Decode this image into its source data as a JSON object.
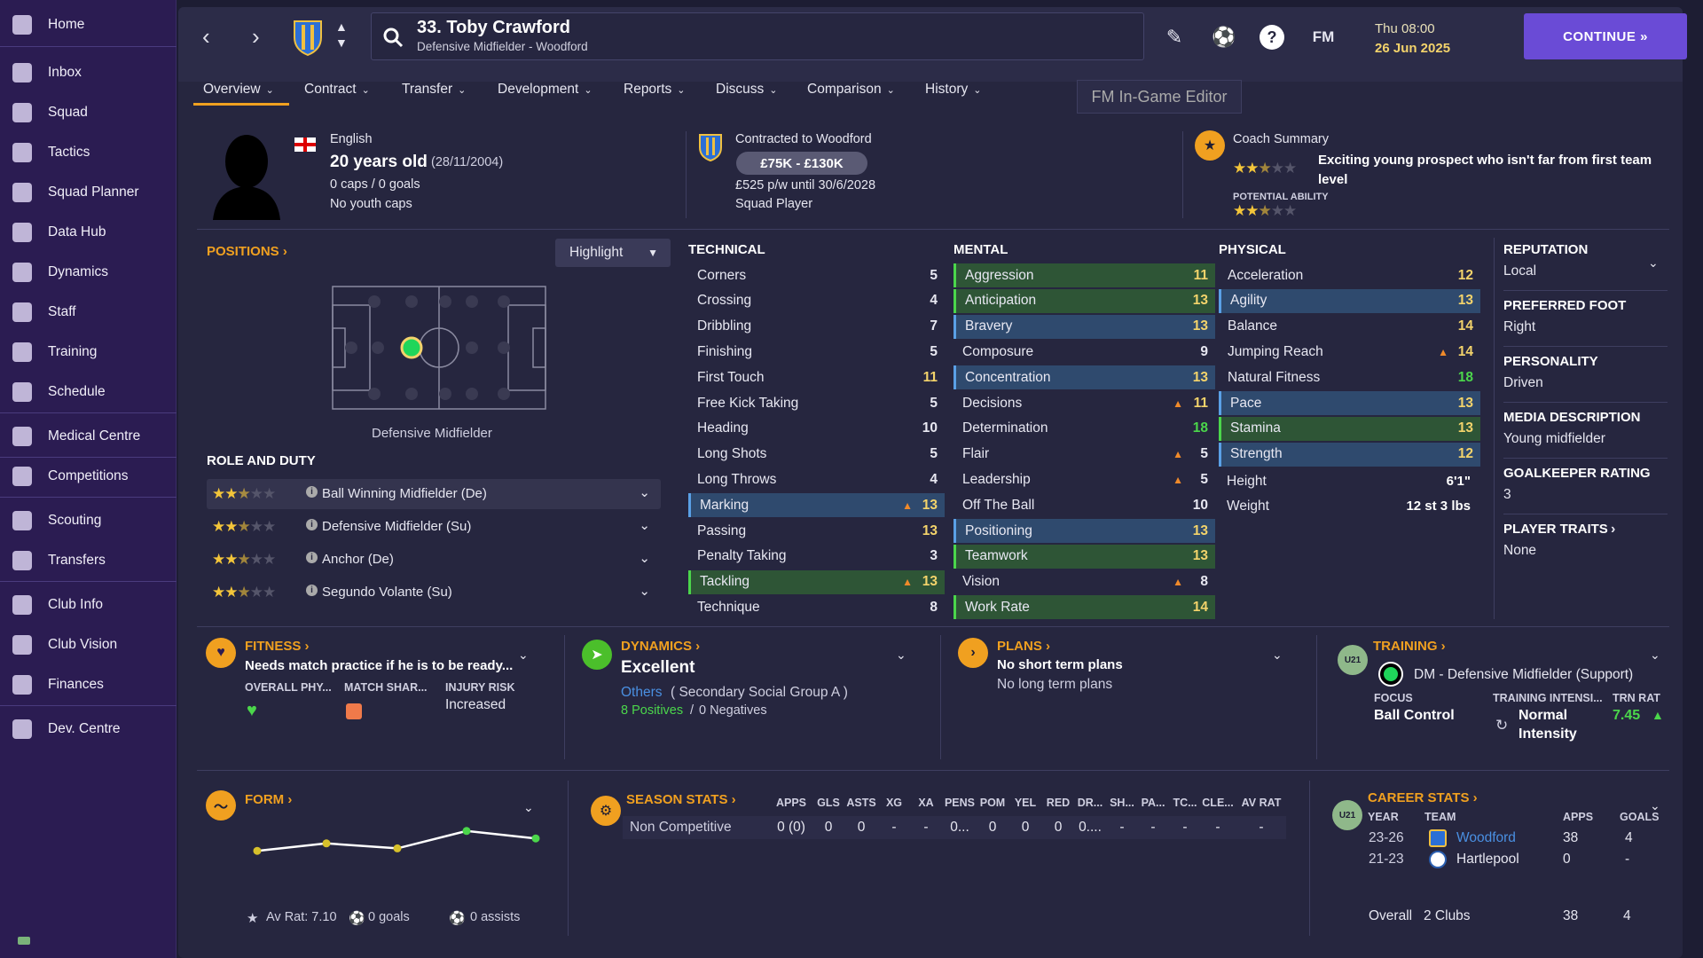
{
  "sidebar": {
    "items": [
      {
        "label": "Home",
        "icon": "home-icon"
      },
      {
        "label": "Inbox",
        "icon": "inbox-icon"
      },
      {
        "label": "Squad",
        "icon": "shirt-icon"
      },
      {
        "label": "Tactics",
        "icon": "tactics-icon"
      },
      {
        "label": "Squad Planner",
        "icon": "planner-icon"
      },
      {
        "label": "Data Hub",
        "icon": "data-hub-icon"
      },
      {
        "label": "Dynamics",
        "icon": "dynamics-icon"
      },
      {
        "label": "Staff",
        "icon": "staff-icon"
      },
      {
        "label": "Training",
        "icon": "training-icon"
      },
      {
        "label": "Schedule",
        "icon": "calendar-icon"
      },
      {
        "label": "Medical Centre",
        "icon": "medical-icon"
      },
      {
        "label": "Competitions",
        "icon": "trophy-icon"
      },
      {
        "label": "Scouting",
        "icon": "scouting-icon"
      },
      {
        "label": "Transfers",
        "icon": "transfers-icon"
      },
      {
        "label": "Club Info",
        "icon": "shield-icon"
      },
      {
        "label": "Club Vision",
        "icon": "vision-icon"
      },
      {
        "label": "Finances",
        "icon": "finances-icon"
      },
      {
        "label": "Dev. Centre",
        "icon": "dev-centre-icon"
      }
    ]
  },
  "header": {
    "name": "33. Toby Crawford",
    "sub": "Defensive Midfielder - Woodford",
    "fm": "FM",
    "date1": "Thu 08:00",
    "date2": "26 Jun 2025",
    "continue": "CONTINUE"
  },
  "tabs": [
    "Overview",
    "Contract",
    "Transfer",
    "Development",
    "Reports",
    "Discuss",
    "Comparison",
    "History"
  ],
  "tooltip": "FM In-Game Editor",
  "profile": {
    "nationality": "English",
    "age": "20 years old",
    "dob": "(28/11/2004)",
    "caps": "0 caps / 0 goals",
    "youth": "No youth caps"
  },
  "contract": {
    "title": "Contracted to Woodford",
    "value": "£75K - £130K",
    "wage": "£525 p/w until 30/6/2028",
    "status": "Squad Player"
  },
  "coach": {
    "title": "Coach Summary",
    "text": "Exciting young prospect who isn't far from first team level",
    "pa_label": "POTENTIAL ABILITY",
    "ca_stars": 2.5,
    "pa_stars": 2.5
  },
  "positions": {
    "title": "POSITIONS",
    "highlight": "Highlight",
    "pos_label": "Defensive Midfielder",
    "role_title": "ROLE AND DUTY",
    "roles": [
      {
        "name": "Ball Winning Midfielder (De)",
        "stars": 2.5
      },
      {
        "name": "Defensive Midfielder (Su)",
        "stars": 2.5
      },
      {
        "name": "Anchor (De)",
        "stars": 2.5
      },
      {
        "name": "Segundo Volante (Su)",
        "stars": 2.5
      }
    ]
  },
  "technical": {
    "title": "TECHNICAL",
    "attrs": [
      {
        "n": "Corners",
        "v": "5"
      },
      {
        "n": "Crossing",
        "v": "4"
      },
      {
        "n": "Dribbling",
        "v": "7"
      },
      {
        "n": "Finishing",
        "v": "5"
      },
      {
        "n": "First Touch",
        "v": "11"
      },
      {
        "n": "Free Kick Taking",
        "v": "5"
      },
      {
        "n": "Heading",
        "v": "10"
      },
      {
        "n": "Long Shots",
        "v": "5"
      },
      {
        "n": "Long Throws",
        "v": "4"
      },
      {
        "n": "Marking",
        "v": "13",
        "hl": "b",
        "up": true
      },
      {
        "n": "Passing",
        "v": "13"
      },
      {
        "n": "Penalty Taking",
        "v": "3"
      },
      {
        "n": "Tackling",
        "v": "13",
        "hl": "g",
        "up": true
      },
      {
        "n": "Technique",
        "v": "8"
      }
    ]
  },
  "mental": {
    "title": "MENTAL",
    "attrs": [
      {
        "n": "Aggression",
        "v": "11",
        "hl": "g"
      },
      {
        "n": "Anticipation",
        "v": "13",
        "hl": "g"
      },
      {
        "n": "Bravery",
        "v": "13",
        "hl": "b"
      },
      {
        "n": "Composure",
        "v": "9"
      },
      {
        "n": "Concentration",
        "v": "13",
        "hl": "b"
      },
      {
        "n": "Decisions",
        "v": "11",
        "up": true
      },
      {
        "n": "Determination",
        "v": "18"
      },
      {
        "n": "Flair",
        "v": "5",
        "up": true
      },
      {
        "n": "Leadership",
        "v": "5",
        "up": true
      },
      {
        "n": "Off The Ball",
        "v": "10"
      },
      {
        "n": "Positioning",
        "v": "13",
        "hl": "b"
      },
      {
        "n": "Teamwork",
        "v": "13",
        "hl": "g"
      },
      {
        "n": "Vision",
        "v": "8",
        "up": true
      },
      {
        "n": "Work Rate",
        "v": "14",
        "hl": "g"
      }
    ]
  },
  "physical": {
    "title": "PHYSICAL",
    "attrs": [
      {
        "n": "Acceleration",
        "v": "12"
      },
      {
        "n": "Agility",
        "v": "13",
        "hl": "b"
      },
      {
        "n": "Balance",
        "v": "14"
      },
      {
        "n": "Jumping Reach",
        "v": "14",
        "up": true
      },
      {
        "n": "Natural Fitness",
        "v": "18"
      },
      {
        "n": "Pace",
        "v": "13",
        "hl": "b"
      },
      {
        "n": "Stamina",
        "v": "13",
        "hl": "g"
      },
      {
        "n": "Strength",
        "v": "12",
        "hl": "b"
      }
    ],
    "height_l": "Height",
    "height": "6'1\"",
    "weight_l": "Weight",
    "weight": "12 st 3 lbs"
  },
  "info": {
    "reputation_l": "REPUTATION",
    "reputation": "Local",
    "foot_l": "PREFERRED FOOT",
    "foot": "Right",
    "pers_l": "PERSONALITY",
    "pers": "Driven",
    "media_l": "MEDIA DESCRIPTION",
    "media": "Young midfielder",
    "gk_l": "GOALKEEPER RATING",
    "gk": "3",
    "traits_l": "PLAYER TRAITS",
    "traits": "None"
  },
  "fitness": {
    "title": "FITNESS",
    "text": "Needs match practice if he is to be ready...",
    "c1": "OVERALL PHY...",
    "c2": "MATCH SHAR...",
    "c3": "INJURY RISK",
    "risk": "Increased"
  },
  "dynamics": {
    "title": "DYNAMICS",
    "value": "Excellent",
    "group_link": "Others",
    "group": "( Secondary Social Group A )",
    "pos": "8 Positives",
    "sep": "/",
    "neg": "0 Negatives"
  },
  "plans": {
    "title": "PLANS",
    "short": "No short term plans",
    "long": "No long term plans"
  },
  "training": {
    "title": "TRAINING",
    "badge": "U21",
    "role": "DM - Defensive Midfielder (Support)",
    "focus_l": "FOCUS",
    "focus": "Ball Control",
    "int_l": "TRAINING INTENSI...",
    "int1": "Normal",
    "int2": "Intensity",
    "rat_l": "TRN RAT",
    "rat": "7.45"
  },
  "form": {
    "title": "FORM",
    "av": "Av Rat: 7.10",
    "goals": "0 goals",
    "assists": "0 assists",
    "points": [
      6.6,
      6.9,
      6.7,
      7.4,
      7.1
    ]
  },
  "season": {
    "title": "SEASON STATS",
    "cols": [
      "APPS",
      "GLS",
      "ASTS",
      "XG",
      "XA",
      "PENS",
      "POM",
      "YEL",
      "RED",
      "DR...",
      "SH...",
      "PA...",
      "TC...",
      "CLE...",
      "AV RAT"
    ],
    "row_label": "Non Competitive",
    "row": [
      "0 (0)",
      "0",
      "0",
      "-",
      "-",
      "0...",
      "0",
      "0",
      "0",
      "0....",
      "-",
      "-",
      "-",
      "-",
      "-"
    ]
  },
  "career": {
    "title": "CAREER STATS",
    "badge": "U21",
    "h_year": "YEAR",
    "h_team": "TEAM",
    "h_apps": "APPS",
    "h_goals": "GOALS",
    "rows": [
      {
        "year": "23-26",
        "team": "Woodford",
        "apps": "38",
        "goals": "4"
      },
      {
        "year": "21-23",
        "team": "Hartlepool",
        "apps": "0",
        "goals": "-"
      }
    ],
    "overall_l": "Overall",
    "overall_c": "2 Clubs",
    "overall_apps": "38",
    "overall_goals": "4"
  }
}
